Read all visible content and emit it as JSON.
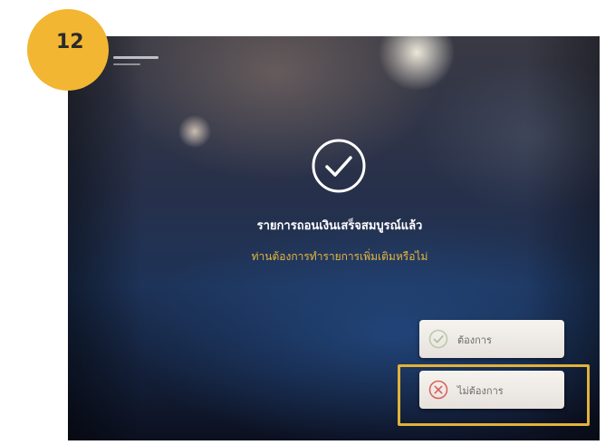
{
  "step": {
    "number": "12",
    "badge_color": "#f2b632"
  },
  "screen": {
    "logo_text": "",
    "success_message": "รายการถอนเงินเสร็จสมบูรณ์แล้ว",
    "question": "ท่านต้องการทำรายการเพิ่มเติมหรือไม่",
    "question_color": "#e7b73c",
    "success_icon": "check-circle-icon"
  },
  "buttons": {
    "yes_label": "ต้องการ",
    "yes_icon": "check-circle-icon",
    "no_label": "ไม่ต้องการ",
    "no_icon": "x-circle-icon",
    "no_icon_color": "#d9605a"
  },
  "highlight": {
    "target": "no-button",
    "color": "#e2b23a"
  }
}
